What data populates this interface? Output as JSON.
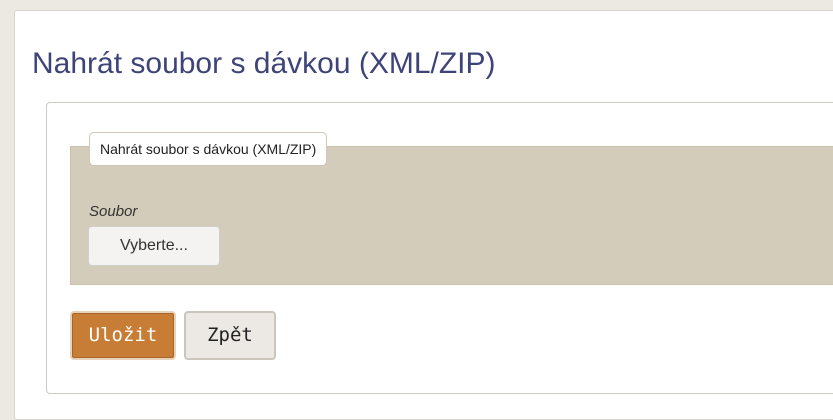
{
  "page": {
    "title": "Nahrát soubor s dávkou (XML/ZIP)"
  },
  "form": {
    "legend": "Nahrát soubor s dávkou (XML/ZIP)",
    "file_field": {
      "label": "Soubor",
      "button_label": "Vyberte..."
    }
  },
  "actions": {
    "save_label": "Uložit",
    "back_label": "Zpět"
  },
  "colors": {
    "title": "#3f4478",
    "fieldset_background": "#d4ccbb",
    "save_button": "#c77d35",
    "back_button": "#ece8e3"
  }
}
